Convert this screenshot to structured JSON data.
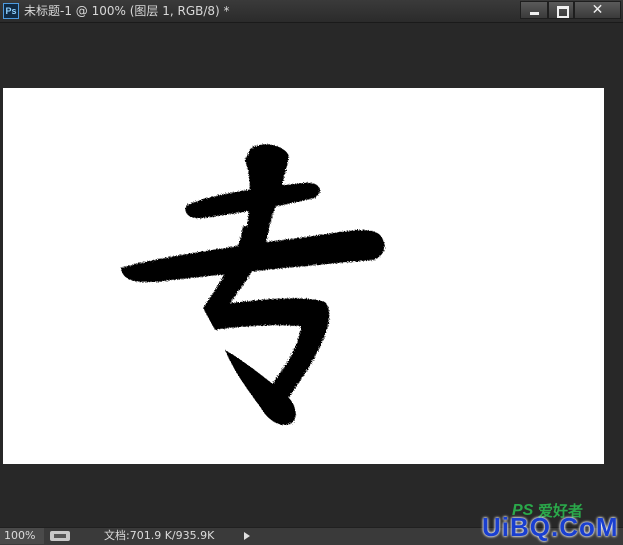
{
  "window": {
    "app_icon": "ps-app-icon",
    "app_icon_text": "Ps",
    "title": "未标题-1 @ 100% (图层 1, RGB/8) *",
    "buttons": {
      "minimize_icon": "minimize-icon",
      "maximize_icon": "maximize-icon",
      "close_icon": "close-icon",
      "close_glyph": "✕"
    }
  },
  "status": {
    "zoom": "100%",
    "doc_size": "文档:701.9 K/935.9K",
    "menu_arrow_icon": "play-arrow-icon"
  },
  "watermark": {
    "ps": "PS",
    "cn": "爱好者",
    "main": "UiBQ.CoM"
  },
  "colors": {
    "workspace_bg": "#282828",
    "canvas_bg": "#ffffff",
    "ink": "#000000"
  }
}
